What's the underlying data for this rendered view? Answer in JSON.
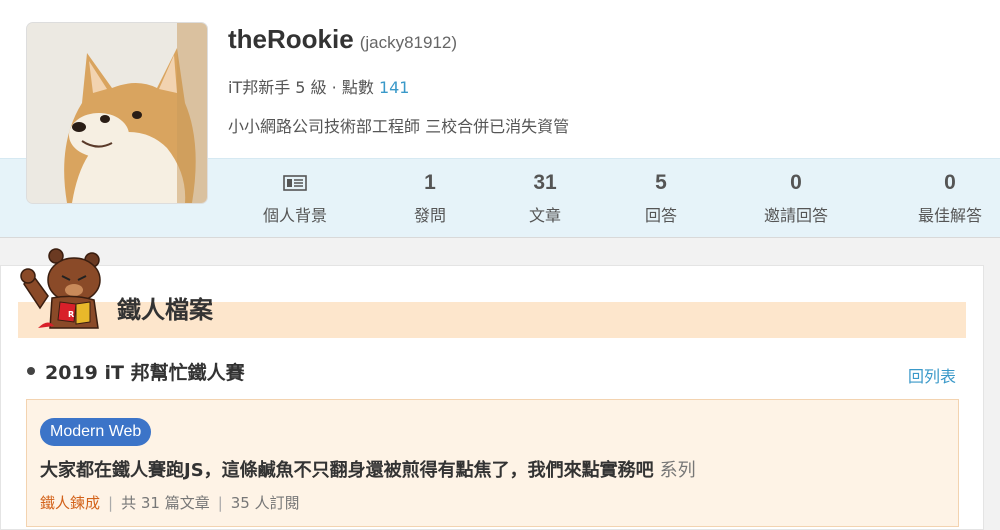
{
  "profile": {
    "name": "theRookie",
    "handle": "(jacky81912)",
    "rank_text": "iT邦新手 5 級 · 點數",
    "points": "141",
    "bio": "小小網路公司技術部工程師 三校合併已消失資管"
  },
  "stats": [
    {
      "icon": "profile-card-icon",
      "label": "個人背景"
    },
    {
      "value": "1",
      "label": "發問"
    },
    {
      "value": "31",
      "label": "文章"
    },
    {
      "value": "5",
      "label": "回答"
    },
    {
      "value": "0",
      "label": "邀請回答"
    },
    {
      "value": "0",
      "label": "最佳解答"
    }
  ],
  "ironman": {
    "section_title": "鐵人檔案",
    "mascot_icon": "bear-mascot-icon",
    "contest_title": "2019 iT 邦幫忙鐵人賽",
    "back_link": "回列表",
    "series": {
      "tag": "Modern Web",
      "title": "大家都在鐵人賽跑JS，這條鹹魚不只翻身還被煎得有點焦了，我們來點實務吧",
      "suffix": "系列",
      "level": "鐵人鍊成",
      "article_count": "共 31 篇文章",
      "subscribers": "35 人訂閱"
    }
  },
  "colors": {
    "link_blue": "#3a99c9",
    "stats_band": "#e6f3f9",
    "ironman_band": "#fde6cc",
    "tag_blue": "#3c74c8",
    "level_orange": "#d3621a"
  }
}
